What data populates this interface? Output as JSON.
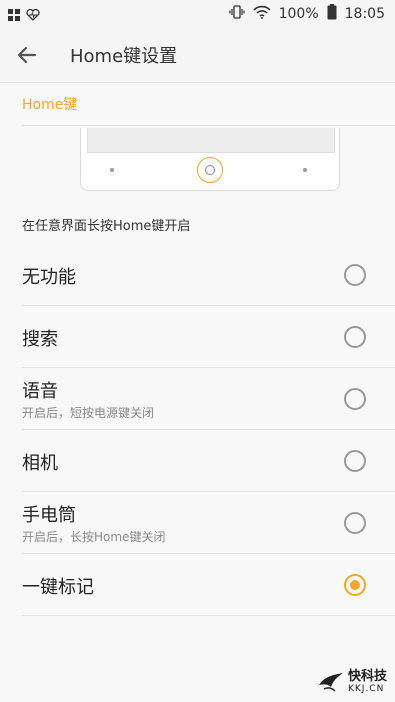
{
  "status_bar": {
    "battery": "100%",
    "time": "18:05"
  },
  "app_bar": {
    "title": "Home键设置"
  },
  "section": {
    "title": "Home键"
  },
  "hint": "在任意界面长按Home键开启",
  "options": [
    {
      "label": "无功能",
      "sub": "",
      "selected": false
    },
    {
      "label": "搜索",
      "sub": "",
      "selected": false
    },
    {
      "label": "语音",
      "sub": "开启后，短按电源键关闭",
      "selected": false
    },
    {
      "label": "相机",
      "sub": "",
      "selected": false
    },
    {
      "label": "手电筒",
      "sub": "开启后，长按Home键关闭",
      "selected": false
    },
    {
      "label": "一键标记",
      "sub": "",
      "selected": true
    }
  ],
  "watermark": {
    "brand": "快科技",
    "domain": "KKJ.CN"
  },
  "colors": {
    "accent": "#f5a623",
    "background": "#f8f8f8"
  }
}
